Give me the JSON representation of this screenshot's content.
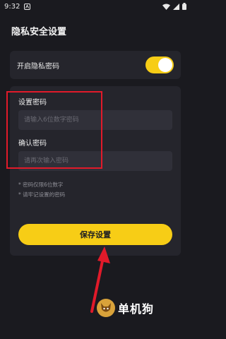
{
  "status_bar": {
    "time": "9:32"
  },
  "page": {
    "title": "隐私安全设置"
  },
  "toggle": {
    "label": "开启隐私密码",
    "on": true
  },
  "password": {
    "set_label": "设置密码",
    "set_placeholder": "请输入6位数字密码",
    "confirm_label": "确认密码",
    "confirm_placeholder": "请再次输入密码"
  },
  "notes": [
    "* 密码仅限6位数字",
    "* 请牢记设置的密码"
  ],
  "save_label": "保存设置",
  "watermark": {
    "text": "单机狗"
  },
  "colors": {
    "accent": "#f7cd16",
    "highlight": "#e11a2a",
    "background": "#1a1a1f",
    "card": "#25252c"
  }
}
